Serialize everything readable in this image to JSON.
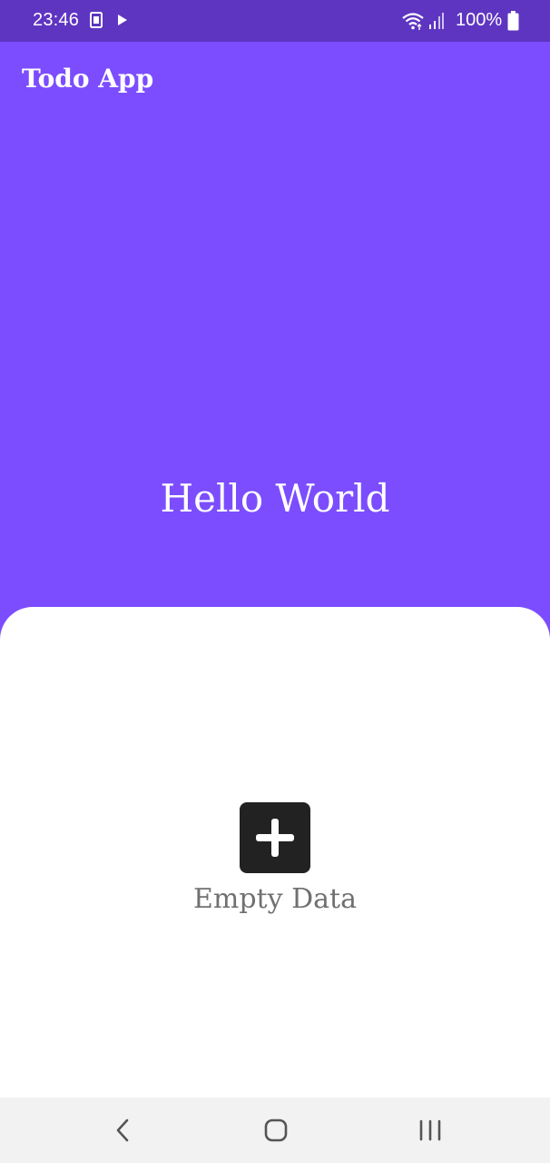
{
  "status_bar": {
    "time": "23:46",
    "battery_percent": "100%",
    "icons": [
      "notification-icon",
      "play-icon",
      "wifi-icon",
      "signal-icon",
      "battery-icon"
    ]
  },
  "app": {
    "title": "Todo App",
    "hero_text": "Hello World",
    "accent_color": "#7c4dff",
    "status_bar_color": "#5e35c1"
  },
  "content": {
    "empty_label": "Empty Data",
    "add_icon": "plus-icon"
  },
  "nav_bar": {
    "buttons": [
      "back-icon",
      "home-icon",
      "recent-apps-icon"
    ]
  }
}
